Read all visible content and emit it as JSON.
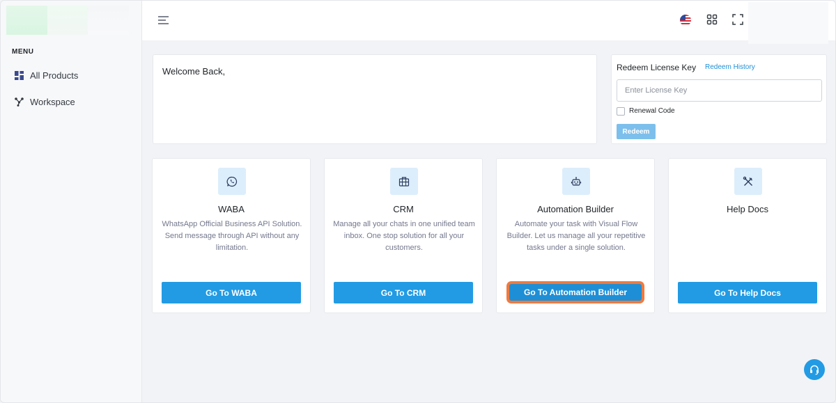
{
  "sidebar": {
    "menu_label": "MENU",
    "items": [
      {
        "label": "All Products",
        "icon": "grid-icon"
      },
      {
        "label": "Workspace",
        "icon": "workspace-nodes-icon"
      }
    ]
  },
  "topbar": {
    "icons": [
      "hamburger-icon",
      "us-flag-icon",
      "apps-grid-icon",
      "fullscreen-icon"
    ]
  },
  "welcome": {
    "text": "Welcome Back,"
  },
  "redeem": {
    "title": "Redeem License Key",
    "history_link": "Redeem History",
    "input_placeholder": "Enter License Key",
    "checkbox_label": "Renewal Code",
    "button_label": "Redeem"
  },
  "products": [
    {
      "icon": "whatsapp-icon",
      "title": "WABA",
      "description": "WhatsApp Official Business API Solution. Send message through API without any limitation.",
      "button": "Go To WABA"
    },
    {
      "icon": "briefcase-icon",
      "title": "CRM",
      "description": "Manage all your chats in one unified team inbox. One stop solution for all your customers.",
      "button": "Go To CRM"
    },
    {
      "icon": "robot-icon",
      "title": "Automation Builder",
      "description": "Automate your task with Visual Flow Builder. Let us manage all your repetitive tasks under a single solution.",
      "button": "Go To Automation Builder"
    },
    {
      "icon": "tools-icon",
      "title": "Help Docs",
      "description": "",
      "button": "Go To Help Docs"
    }
  ],
  "colors": {
    "accent": "#229be4",
    "highlight_ring": "#f07a3f",
    "icon_box": "#dceefb"
  }
}
